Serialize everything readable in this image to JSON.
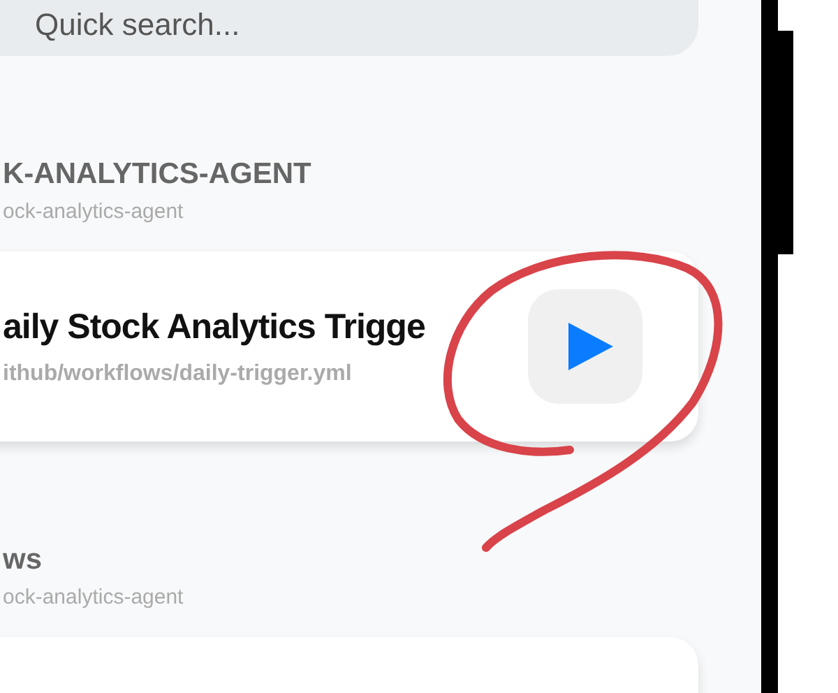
{
  "search": {
    "placeholder": "Quick search..."
  },
  "sections": [
    {
      "title": "K-ANALYTICS-AGENT",
      "subtitle": "ock-analytics-agent",
      "cards": [
        {
          "title": "aily Stock Analytics Trigge",
          "path": "ithub/workflows/daily-trigger.yml"
        }
      ]
    },
    {
      "title": "ws",
      "subtitle": "ock-analytics-agent",
      "cards": [
        {
          "kind": "partial"
        }
      ]
    }
  ]
}
